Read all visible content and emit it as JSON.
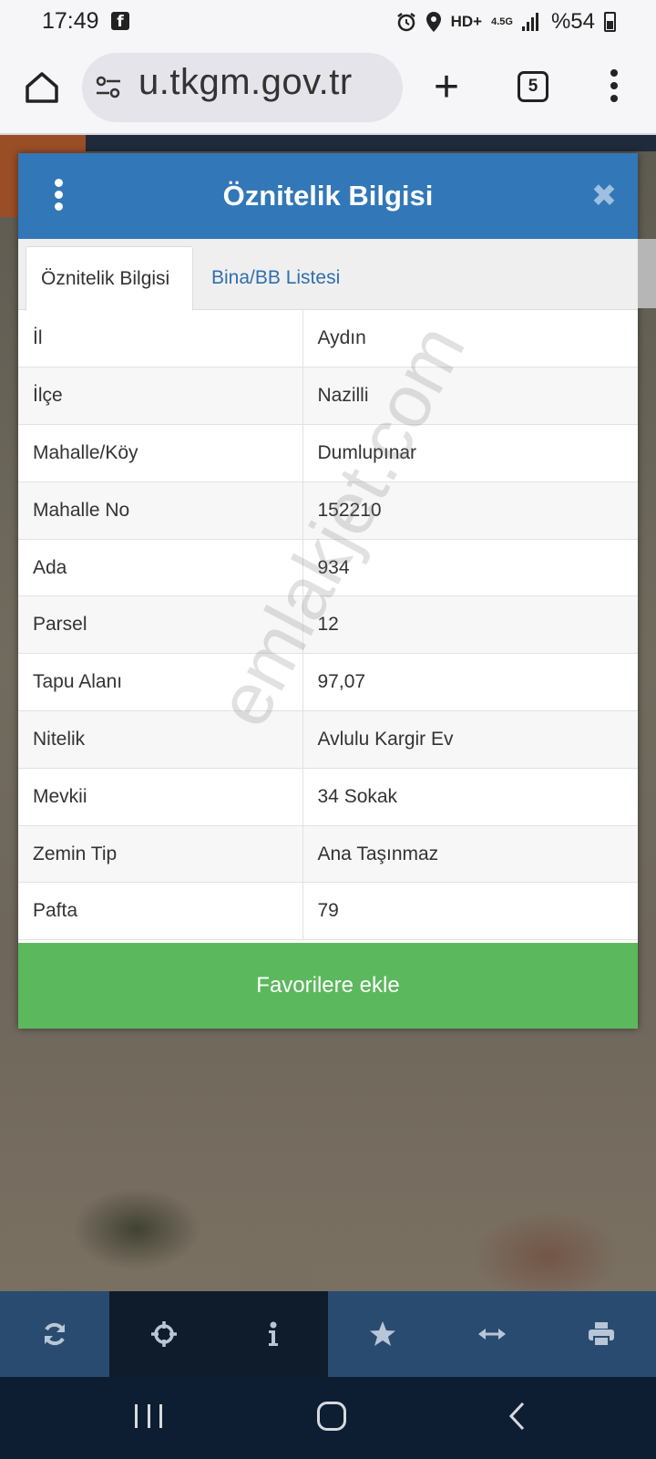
{
  "status_bar": {
    "time": "17:49",
    "network": "4.5G",
    "battery": "%54",
    "hd_label": "HD+"
  },
  "browser": {
    "url": "u.tkgm.gov.tr",
    "tab_count": "5",
    "new_tab": "+"
  },
  "modal": {
    "title": "Öznitelik Bilgisi",
    "close_glyph": "✖",
    "tabs": [
      {
        "label": "Öznitelik Bilgisi",
        "active": true
      },
      {
        "label": "Bina/BB Listesi",
        "active": false
      }
    ],
    "rows": [
      {
        "key": "İl",
        "value": "Aydın"
      },
      {
        "key": "İlçe",
        "value": "Nazilli"
      },
      {
        "key": "Mahalle/Köy",
        "value": "Dumlupınar"
      },
      {
        "key": "Mahalle No",
        "value": "152210"
      },
      {
        "key": "Ada",
        "value": "934"
      },
      {
        "key": "Parsel",
        "value": "12"
      },
      {
        "key": "Tapu Alanı",
        "value": "97,07"
      },
      {
        "key": "Nitelik",
        "value": "Avlulu Kargir Ev"
      },
      {
        "key": "Mevkii",
        "value": "34 Sokak"
      },
      {
        "key": "Zemin Tip",
        "value": "Ana Taşınmaz"
      },
      {
        "key": "Pafta",
        "value": "79"
      }
    ],
    "favorite_button": "Favorilere ekle"
  },
  "watermark": "emlakjet.com",
  "toolbar": {
    "buttons": [
      {
        "icon": "refresh-icon",
        "active": false
      },
      {
        "icon": "crosshair-icon",
        "active": true
      },
      {
        "icon": "info-icon",
        "active": true
      },
      {
        "icon": "star-icon",
        "active": false
      },
      {
        "icon": "measure-arrows-icon",
        "active": false
      },
      {
        "icon": "print-icon",
        "active": false
      }
    ]
  },
  "colors": {
    "header_blue": "#3277b8",
    "tab_link_blue": "#2f6fae",
    "favorite_green": "#5cb85c",
    "toolbar_blue": "#2a4b70",
    "nav_bar": "#0d1e33"
  }
}
